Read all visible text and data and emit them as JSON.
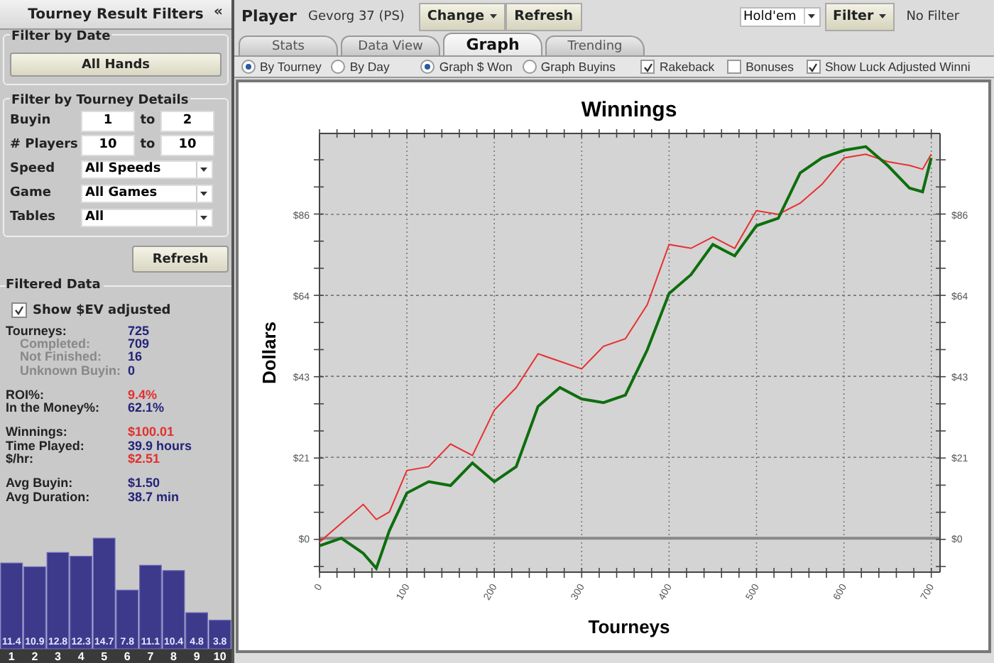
{
  "sidebar": {
    "title": "Tourney Result Filters",
    "collapse_icon": "«",
    "date_filter": {
      "title": "Filter by Date",
      "button": "All Hands"
    },
    "details_filter": {
      "title": "Filter by Tourney Details",
      "rows": [
        {
          "kind": "range",
          "label": "Buyin",
          "from": "1",
          "separator": "to",
          "to": "2"
        },
        {
          "kind": "range",
          "label": "# Players",
          "from": "10",
          "separator": "to",
          "to": "10"
        },
        {
          "kind": "select",
          "label": "Speed",
          "value": "All Speeds"
        },
        {
          "kind": "select",
          "label": "Game",
          "value": "All Games"
        },
        {
          "kind": "select",
          "label": "Tables",
          "value": "All"
        }
      ],
      "refresh_button": "Refresh"
    },
    "filtered_data": {
      "title": "Filtered Data",
      "ev_checkbox": {
        "label": "Show $EV adjusted",
        "checked": true
      },
      "stat_groups": [
        [
          {
            "kind": "main",
            "label": "Tourneys:",
            "value": "725",
            "color": "#23237a"
          },
          {
            "kind": "sub",
            "label": "Completed:",
            "value": "709",
            "color": "#23237a"
          },
          {
            "kind": "sub",
            "label": "Not Finished:",
            "value": "16",
            "color": "#23237a"
          },
          {
            "kind": "sub",
            "label": "Unknown Buyin:",
            "value": "0",
            "color": "#23237a"
          }
        ],
        [
          {
            "kind": "main",
            "label": "ROI%:",
            "value": "9.4%",
            "color": "#e03030"
          },
          {
            "kind": "main",
            "label": "In the Money%:",
            "value": "62.1%",
            "color": "#23237a"
          }
        ],
        [
          {
            "kind": "main",
            "label": "Winnings:",
            "value": "$100.01",
            "color": "#e03030"
          },
          {
            "kind": "main",
            "label": "Time Played:",
            "value": "39.9 hours",
            "color": "#23237a"
          },
          {
            "kind": "main",
            "label": "$/hr:",
            "value": "$2.51",
            "color": "#e03030"
          }
        ],
        [
          {
            "kind": "main",
            "label": "Avg Buyin:",
            "value": "$1.50",
            "color": "#23237a"
          },
          {
            "kind": "main",
            "label": "Avg Duration:",
            "value": "38.7 min",
            "color": "#23237a"
          }
        ]
      ],
      "histogram": {
        "chart_data": {
          "type": "bar",
          "categories": [
            "1",
            "2",
            "3",
            "4",
            "5",
            "6",
            "7",
            "8",
            "9",
            "10"
          ],
          "values": [
            11.4,
            10.9,
            12.8,
            12.3,
            14.7,
            7.8,
            11.1,
            10.4,
            4.8,
            3.8
          ],
          "data_labels": true
        }
      }
    }
  },
  "toolbar": {
    "player_label": "Player",
    "player": "Gevorg 37 (PS)",
    "change_button": "Change",
    "refresh_button": "Refresh",
    "game_select": "Hold'em",
    "filter_button": "Filter",
    "filter_status": "No Filter"
  },
  "tabs": [
    {
      "label": "Stats",
      "selected": false
    },
    {
      "label": "Data View",
      "selected": false
    },
    {
      "label": "Graph",
      "selected": true
    },
    {
      "label": "Trending",
      "selected": false
    }
  ],
  "options": {
    "radio_groups": [
      [
        {
          "label": "By Tourney",
          "selected": true
        },
        {
          "label": "By Day",
          "selected": false
        }
      ],
      [
        {
          "label": "Graph $ Won",
          "selected": true
        },
        {
          "label": "Graph Buyins",
          "selected": false
        }
      ]
    ],
    "checkboxes": [
      {
        "label": "Rakeback",
        "checked": true
      },
      {
        "label": "Bonuses",
        "checked": false
      },
      {
        "label": "Show Luck Adjusted Winni",
        "checked": true
      }
    ]
  },
  "graph": {
    "chart_data": {
      "type": "line",
      "title": "Winnings",
      "xlabel": "Tourneys",
      "ylabel": "Dollars",
      "x": [
        0,
        25,
        50,
        65,
        80,
        100,
        125,
        150,
        175,
        200,
        225,
        250,
        275,
        300,
        325,
        350,
        375,
        400,
        425,
        450,
        475,
        500,
        525,
        550,
        575,
        600,
        625,
        650,
        675,
        690,
        700
      ],
      "grid": true,
      "xlim": [
        0,
        710
      ],
      "ylim": [
        -9,
        107.5
      ],
      "xticks": [
        0,
        100,
        200,
        300,
        400,
        500,
        600,
        700
      ],
      "yticks": [
        {
          "value": 0,
          "label": "$0"
        },
        {
          "value": 21.5,
          "label": "$21"
        },
        {
          "value": 43,
          "label": "$43"
        },
        {
          "value": 64.5,
          "label": "$64"
        },
        {
          "value": 86,
          "label": "$86"
        }
      ],
      "series": [
        {
          "color": "#e83030",
          "values": [
            -1,
            4,
            9,
            5,
            7,
            18,
            19,
            25,
            22,
            34,
            40,
            49,
            47,
            45,
            51,
            53,
            62,
            78,
            77,
            80,
            77,
            87,
            86,
            89,
            94,
            101,
            102,
            100,
            99,
            98,
            102
          ]
        },
        {
          "color": "#0e6e0e",
          "values": [
            -2,
            0,
            -4,
            -8,
            2,
            12,
            15,
            14,
            20,
            15,
            19,
            35,
            40,
            37,
            36,
            38,
            50,
            65,
            70,
            78,
            75,
            83,
            85,
            97,
            101,
            103,
            104,
            99,
            93,
            92,
            101
          ]
        }
      ]
    }
  }
}
